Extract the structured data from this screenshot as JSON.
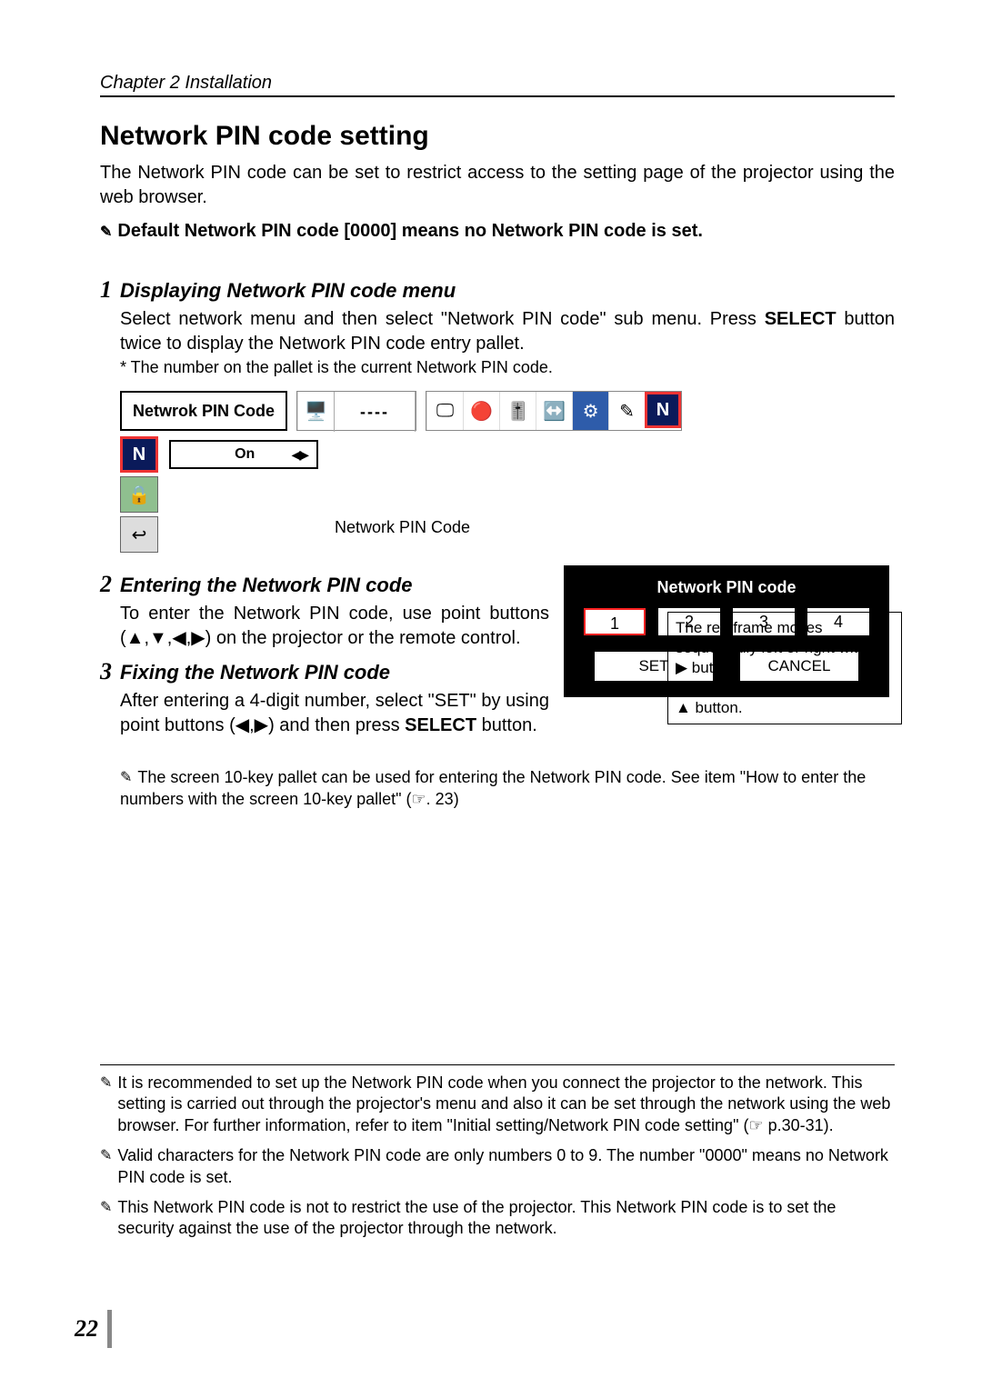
{
  "chapter_header": "Chapter 2 Installation",
  "main_title": "Network PIN code setting",
  "intro_text": "The Network PIN code can be set to restrict access to the setting page of the projector using the web browser.",
  "default_note": "Default Network PIN code [0000] means no Network PIN code is set.",
  "step1": {
    "num": "1",
    "title": "Displaying Network PIN code menu",
    "body_1": "Select network menu and then select \"Network PIN code\" sub menu. Press ",
    "select_word": "SELECT",
    "body_2": " button twice to display the Network PIN code entry pallet.",
    "note": "* The number on the pallet is the current Network PIN code."
  },
  "menu_bar": {
    "label": "Netwrok PIN Code",
    "dashes": "----"
  },
  "submenu": {
    "on_label": "On",
    "caption": "Network PIN Code"
  },
  "redframe_box": {
    "line1": "The red frame moves sequentially left or right with ◀ ▶ button.",
    "line2": "The number up or down with ▼ ▲ button."
  },
  "step2": {
    "num": "2",
    "title": "Entering the Network PIN code",
    "body": "To enter the Network PIN code, use point buttons (▲,▼,◀,▶) on the  projector or the remote control."
  },
  "step3": {
    "num": "3",
    "title": "Fixing the Network PIN code",
    "body_1": "After entering a 4-digit number, select \"SET\" by using point buttons (◀,▶) and then press ",
    "select_word": "SELECT",
    "body_2": " button."
  },
  "pin_dialog": {
    "title": "Network PIN code",
    "d1": "1",
    "d2": "2",
    "d3": "3",
    "d4": "4",
    "set": "SET",
    "cancel": "CANCEL"
  },
  "mid_note": {
    "line1": "The screen 10-key pallet can be used for entering the Network PIN code. See item \"How to enter the numbers with the screen 10-key pallet\" (☞. 23)"
  },
  "footnotes": {
    "f1": "It is recommended to set up the Network PIN code when you connect the projector to the network. This setting is carried out through the projector's menu and also it can be set through the network using the web browser. For further information, refer to item \"Initial setting/Network PIN code setting\" (☞ p.30-31).",
    "f2": "Valid characters for the Network PIN code are only numbers 0 to 9. The number \"0000\" means no Network PIN code is set.",
    "f3": "This Network PIN code is not to restrict the use of the projector. This Network PIN code is to set the security against the use of the projector through the network."
  },
  "page_num": "22"
}
